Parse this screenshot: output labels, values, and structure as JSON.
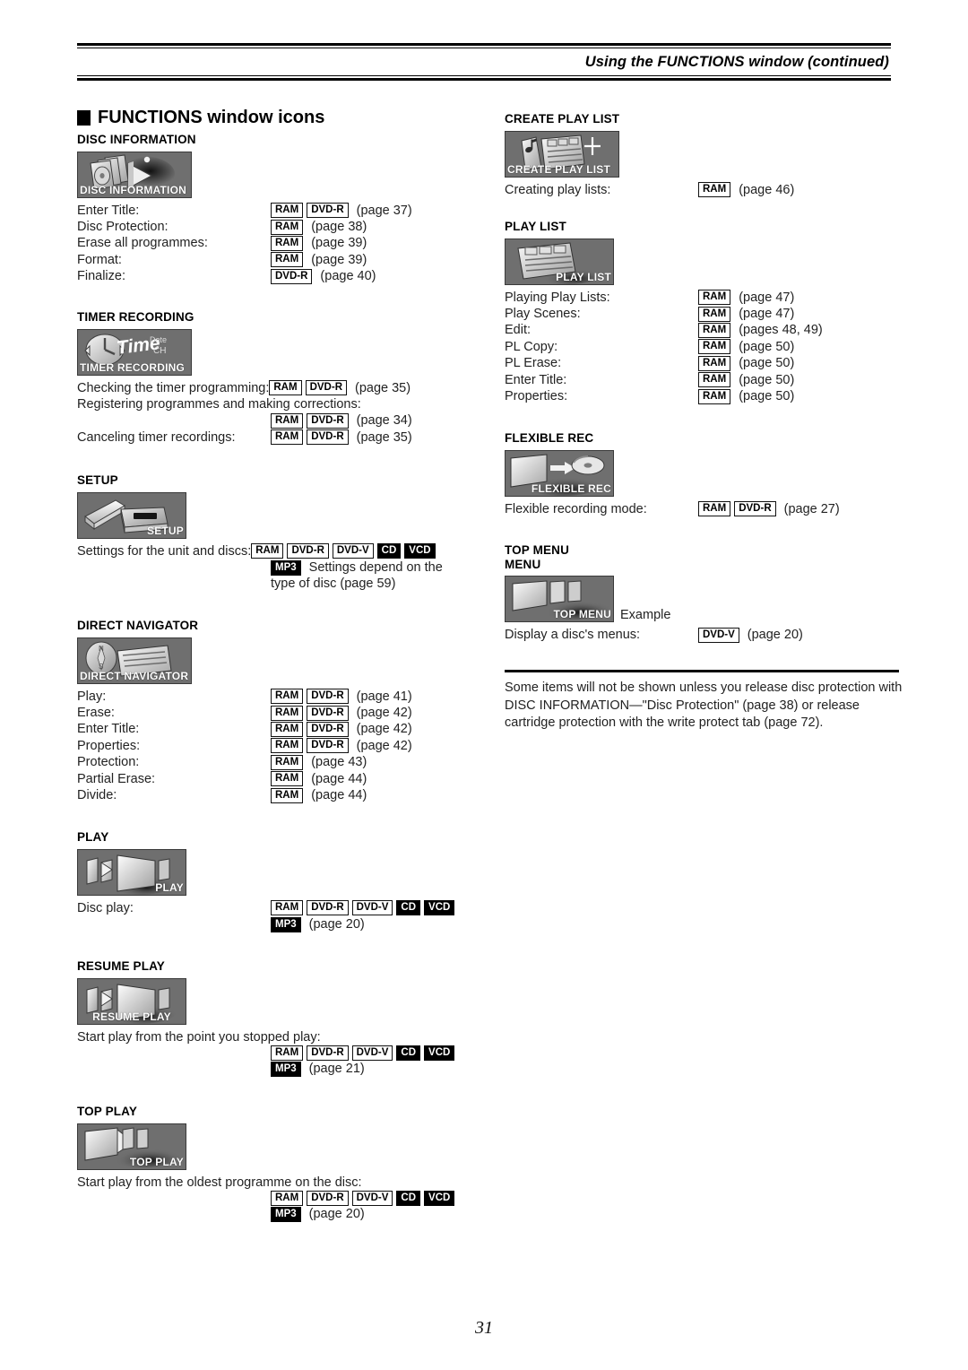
{
  "header": {
    "title": "Using the FUNCTIONS window (continued)"
  },
  "section": {
    "title": "FUNCTIONS window icons"
  },
  "page_number": "31",
  "note": "Some items will not be shown unless you release disc protection with DISC INFORMATION—\"Disc Protection\" (page 38) or release cartridge protection with the write protect tab (page 72).",
  "left": [
    {
      "title": "DISC INFORMATION",
      "icon_caption": "DISC  INFORMATION",
      "rows": [
        {
          "label": "Enter Title:",
          "badges": [
            "RAM",
            "DVD-R"
          ],
          "page": "(page 37)"
        },
        {
          "label": "Disc Protection:",
          "badges": [
            "RAM"
          ],
          "page": "(page 38)"
        },
        {
          "label": "Erase all programmes:",
          "badges": [
            "RAM"
          ],
          "page": "(page 39)"
        },
        {
          "label": "Format:",
          "badges": [
            "RAM"
          ],
          "page": "(page 39)"
        },
        {
          "label": "Finalize:",
          "badges": [
            "DVD-R"
          ],
          "page": "(page 40)"
        }
      ]
    },
    {
      "title": "TIMER RECORDING",
      "icon_caption": "TIMER  RECORDING",
      "rows": [
        {
          "label": "Checking the timer programming:",
          "badges": [
            "RAM",
            "DVD-R"
          ],
          "page": "(page 35)",
          "tight": true
        },
        {
          "label": "Registering programmes and making corrections:",
          "badges": [],
          "page": "",
          "full": true
        },
        {
          "label": "",
          "badges": [
            "RAM",
            "DVD-R"
          ],
          "page": "(page 34)",
          "indent": true
        },
        {
          "label": "Canceling timer recordings:",
          "badges": [
            "RAM",
            "DVD-R"
          ],
          "page": "(page 35)"
        }
      ]
    },
    {
      "title": "SETUP",
      "icon_caption": "SETUP",
      "rows": [
        {
          "label": "Settings for the unit and discs:",
          "badges": [
            "RAM",
            "DVD-R",
            "DVD-V",
            "CD",
            "VCD"
          ],
          "page": "",
          "tight": true
        },
        {
          "label": "",
          "badges": [
            "MP3"
          ],
          "page": "Settings depend on the",
          "indent": true
        },
        {
          "label": "",
          "badges": [],
          "page": "",
          "text": "type of disc (page 59)",
          "indent": true
        }
      ]
    },
    {
      "title": "DIRECT NAVIGATOR",
      "icon_caption": "DIRECT  NAVIGATOR",
      "rows": [
        {
          "label": "Play:",
          "badges": [
            "RAM",
            "DVD-R"
          ],
          "page": "(page 41)"
        },
        {
          "label": "Erase:",
          "badges": [
            "RAM",
            "DVD-R"
          ],
          "page": "(page 42)"
        },
        {
          "label": "Enter Title:",
          "badges": [
            "RAM",
            "DVD-R"
          ],
          "page": "(page 42)"
        },
        {
          "label": "Properties:",
          "badges": [
            "RAM",
            "DVD-R"
          ],
          "page": "(page 42)"
        },
        {
          "label": "Protection:",
          "badges": [
            "RAM"
          ],
          "page": "(page 43)"
        },
        {
          "label": "Partial Erase:",
          "badges": [
            "RAM"
          ],
          "page": "(page 44)"
        },
        {
          "label": "Divide:",
          "badges": [
            "RAM"
          ],
          "page": "(page 44)"
        }
      ]
    },
    {
      "title": "PLAY",
      "icon_caption": "PLAY",
      "rows": [
        {
          "label": "Disc play:",
          "badges": [
            "RAM",
            "DVD-R",
            "DVD-V",
            "CD",
            "VCD"
          ],
          "page": ""
        },
        {
          "label": "",
          "badges": [
            "MP3"
          ],
          "page": "(page 20)",
          "indent": true
        }
      ]
    },
    {
      "title": "RESUME PLAY",
      "icon_caption": "RESUME  PLAY",
      "rows": [
        {
          "label": "Start play from the point you stopped play:",
          "badges": [],
          "page": "",
          "full": true
        },
        {
          "label": "",
          "badges": [
            "RAM",
            "DVD-R",
            "DVD-V",
            "CD",
            "VCD"
          ],
          "page": "",
          "indent": true
        },
        {
          "label": "",
          "badges": [
            "MP3"
          ],
          "page": "(page 21)",
          "indent": true
        }
      ]
    },
    {
      "title": "TOP PLAY",
      "icon_caption": "TOP  PLAY",
      "rows": [
        {
          "label": "Start play from the oldest programme on the disc:",
          "badges": [],
          "page": "",
          "full": true
        },
        {
          "label": "",
          "badges": [
            "RAM",
            "DVD-R",
            "DVD-V",
            "CD",
            "VCD"
          ],
          "page": "",
          "indent": true
        },
        {
          "label": "",
          "badges": [
            "MP3"
          ],
          "page": "(page 20)",
          "indent": true
        }
      ]
    }
  ],
  "right": [
    {
      "title": "CREATE PLAY LIST",
      "icon_caption": "CREATE  PLAY  LIST",
      "rows": [
        {
          "label": "Creating play lists:",
          "badges": [
            "RAM"
          ],
          "page": "(page 46)"
        }
      ]
    },
    {
      "title": "PLAY LIST",
      "icon_caption": "PLAY  LIST",
      "rows": [
        {
          "label": "Playing Play Lists:",
          "badges": [
            "RAM"
          ],
          "page": "(page 47)"
        },
        {
          "label": "Play Scenes:",
          "badges": [
            "RAM"
          ],
          "page": "(page 47)"
        },
        {
          "label": "Edit:",
          "badges": [
            "RAM"
          ],
          "page": "(pages 48, 49)"
        },
        {
          "label": "PL Copy:",
          "badges": [
            "RAM"
          ],
          "page": "(page 50)"
        },
        {
          "label": "PL Erase:",
          "badges": [
            "RAM"
          ],
          "page": "(page 50)"
        },
        {
          "label": "Enter Title:",
          "badges": [
            "RAM"
          ],
          "page": "(page 50)"
        },
        {
          "label": "Properties:",
          "badges": [
            "RAM"
          ],
          "page": "(page 50)"
        }
      ]
    },
    {
      "title": "FLEXIBLE REC",
      "icon_caption": "FLEXIBLE  REC",
      "rows": [
        {
          "label": "Flexible recording mode:",
          "badges": [
            "RAM",
            "DVD-R"
          ],
          "page": "(page 27)"
        }
      ]
    },
    {
      "title": "TOP MENU\nMENU",
      "icon_caption": "TOP  MENU",
      "icon_suffix": "Example",
      "rows": [
        {
          "label": "Display a disc's menus:",
          "badges": [
            "DVD-V"
          ],
          "page": "(page 20)"
        }
      ]
    }
  ],
  "badge_styles": {
    "RAM": "outline",
    "DVD-R": "outline",
    "DVD-V": "outline",
    "CD": "inverted",
    "VCD": "inverted",
    "MP3": "inverted"
  },
  "icons": {
    "disc-information": "disc-and-pages-icon",
    "timer-recording": "clock-time-date-ch-icon",
    "setup": "deck-and-panel-icon",
    "direct-navigator": "compass-and-list-icon",
    "play": "play-arrow-screens-icon",
    "resume-play": "play-arrow-screens-icon",
    "top-play": "screens-arrow-icon",
    "create-play-list": "note-and-list-plus-icon",
    "play-list": "list-sheet-icon",
    "flexible-rec": "screen-to-disc-icon",
    "top-menu": "menu-screens-icon"
  }
}
